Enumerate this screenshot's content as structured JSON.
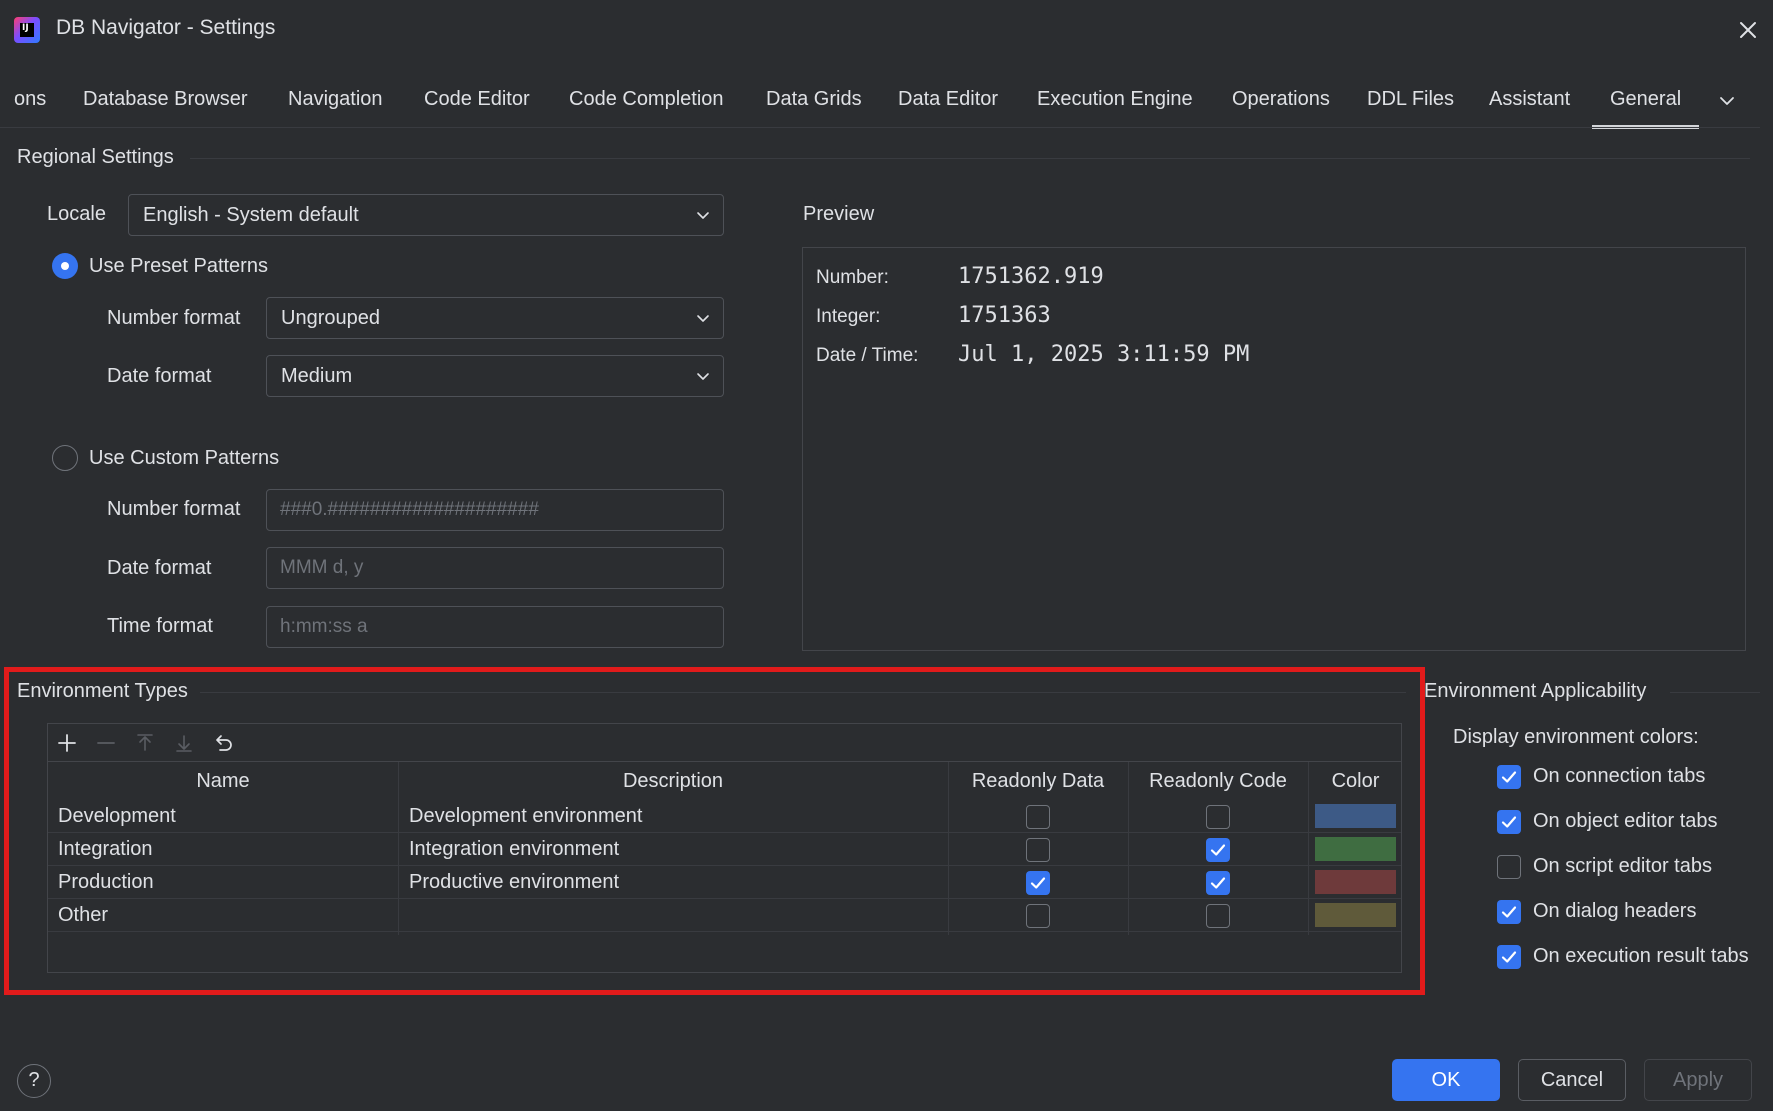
{
  "window": {
    "title": "DB Navigator - Settings",
    "icon": "intellij-icon"
  },
  "tabs": [
    {
      "label": "ons"
    },
    {
      "label": "Database Browser"
    },
    {
      "label": "Navigation"
    },
    {
      "label": "Code Editor"
    },
    {
      "label": "Code Completion"
    },
    {
      "label": "Data Grids"
    },
    {
      "label": "Data Editor"
    },
    {
      "label": "Execution Engine"
    },
    {
      "label": "Operations"
    },
    {
      "label": "DDL Files"
    },
    {
      "label": "Assistant"
    },
    {
      "label": "General",
      "active": true
    }
  ],
  "regional": {
    "section_title": "Regional Settings",
    "locale_label": "Locale",
    "locale_value": "English - System default",
    "preset_label": "Use Preset Patterns",
    "preset_number_label": "Number format",
    "preset_number_value": "Ungrouped",
    "preset_date_label": "Date format",
    "preset_date_value": "Medium",
    "custom_label": "Use Custom Patterns",
    "custom_number_label": "Number format",
    "custom_number_placeholder": "###0.####################",
    "custom_date_label": "Date format",
    "custom_date_placeholder": "MMM d, y",
    "custom_time_label": "Time format",
    "custom_time_placeholder": "h:mm:ss a"
  },
  "preview": {
    "title": "Preview",
    "number_label": "Number:",
    "number_value": "1751362.919",
    "integer_label": "Integer:",
    "integer_value": "1751363",
    "datetime_label": "Date / Time:",
    "datetime_value": "Jul 1, 2025 3:11:59 PM"
  },
  "environment_types": {
    "section_title": "Environment Types",
    "columns": {
      "name": "Name",
      "description": "Description",
      "readonly_data": "Readonly Data",
      "readonly_code": "Readonly Code",
      "color": "Color"
    },
    "rows": [
      {
        "name": "Development",
        "description": "Development environment",
        "readonly_data": false,
        "readonly_code": false,
        "color": "#3d5a86"
      },
      {
        "name": "Integration",
        "description": "Integration environment",
        "readonly_data": false,
        "readonly_code": true,
        "color": "#3f6d41"
      },
      {
        "name": "Production",
        "description": "Productive environment",
        "readonly_data": true,
        "readonly_code": true,
        "color": "#6e3a3b"
      },
      {
        "name": "Other",
        "description": "",
        "readonly_data": false,
        "readonly_code": false,
        "color": "#5f5a3a"
      }
    ]
  },
  "applicability": {
    "section_title": "Environment Applicability",
    "display_label": "Display environment colors:",
    "options": [
      {
        "label": "On connection tabs",
        "checked": true
      },
      {
        "label": "On object editor tabs",
        "checked": true
      },
      {
        "label": "On script editor tabs",
        "checked": false
      },
      {
        "label": "On dialog headers",
        "checked": true
      },
      {
        "label": "On execution result tabs",
        "checked": true
      }
    ]
  },
  "buttons": {
    "help": "?",
    "ok": "OK",
    "cancel": "Cancel",
    "apply": "Apply"
  },
  "colors": {
    "accent": "#3574f0",
    "background": "#2b2d30",
    "highlight": "#e11b1b"
  }
}
